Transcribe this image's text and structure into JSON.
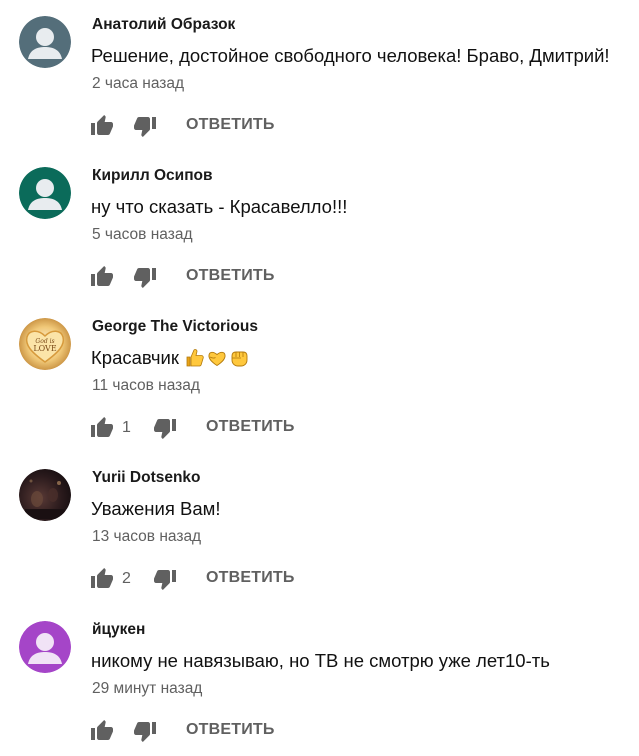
{
  "colors": {
    "thumb_icon": "#606060",
    "author_text": "#1a1a1a",
    "meta_text": "#606060",
    "body_text": "#111111"
  },
  "comments": [
    {
      "author": "Анатолий Образок",
      "text": "Решение, достойное свободного человека! Браво, Дмитрий!",
      "time": "2 часа назад",
      "likes": "",
      "reply_label": "ОТВЕТИТЬ",
      "avatar": "default-avatar",
      "avatar_color": "#546e7a"
    },
    {
      "author": "Кирилл Осипов",
      "text": "ну что сказать - Красавелло!!!",
      "time": "5 часов назад",
      "likes": "",
      "reply_label": "ОТВЕТИТЬ",
      "avatar": "default-avatar",
      "avatar_color": "#0b6b5a"
    },
    {
      "author": "George The Victorious",
      "text": "Красавчик",
      "emojis": [
        "thumbs-up-emoji",
        "yellow-heart-emoji",
        "fist-emoji"
      ],
      "time": "11 часов назад",
      "likes": "1",
      "reply_label": "ОТВЕТИТЬ",
      "avatar": "god-is-love-heart-photo",
      "avatar_text": [
        "God is",
        "LOVE"
      ]
    },
    {
      "author": "Yurii Dotsenko",
      "text": "Уважения Вам!",
      "time": "13 часов назад",
      "likes": "2",
      "reply_label": "ОТВЕТИТЬ",
      "avatar": "dark-photo"
    },
    {
      "author": "йцукен",
      "text": "никому не навязываю, но ТВ не смотрю уже лет10-ть",
      "time": "29 минут назад",
      "likes": "",
      "reply_label": "ОТВЕТИТЬ",
      "avatar": "default-avatar",
      "avatar_color": "#a545c8"
    }
  ]
}
